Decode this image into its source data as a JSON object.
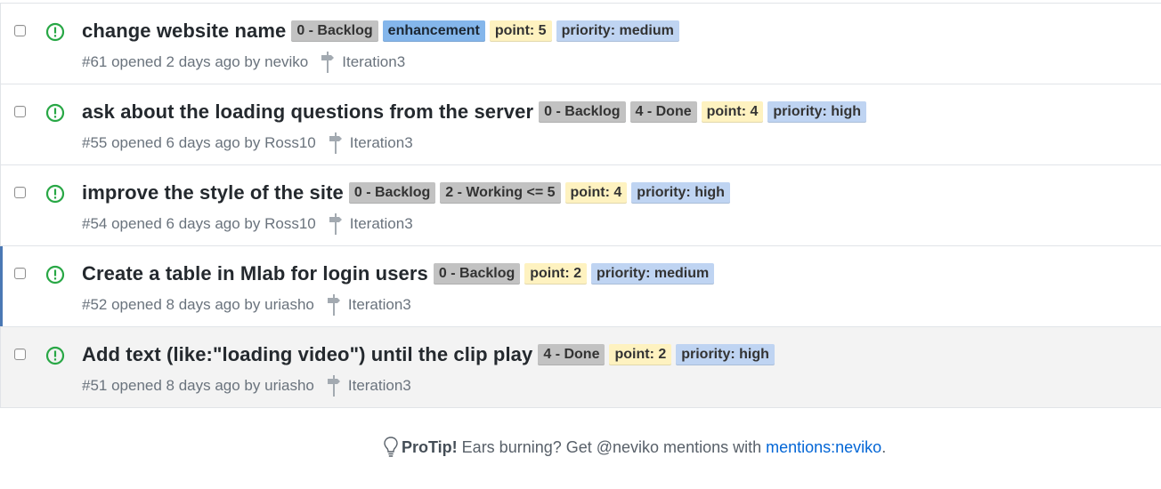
{
  "colors": {
    "open_icon": "#28a745",
    "backlog_bg": "#c2c2c2",
    "done_bg": "#c2c2c2",
    "working_bg": "#c2c2c2",
    "enhancement_bg": "#84b6eb",
    "point_bg": "#fef2c0",
    "priority_bg": "#bfd4f2",
    "active_bar": "#4a78b4",
    "link": "#0366d6"
  },
  "issues": [
    {
      "title": "change website name",
      "labels": [
        "0 - Backlog",
        "enhancement",
        "point: 5",
        "priority: medium"
      ],
      "meta": "#61 opened 2 days ago by neviko",
      "milestone": "Iteration3"
    },
    {
      "title": "ask about the loading questions from the server",
      "labels": [
        "0 - Backlog",
        "4 - Done",
        "point: 4",
        "priority: high"
      ],
      "meta": "#55 opened 6 days ago by Ross10",
      "milestone": "Iteration3"
    },
    {
      "title": "improve the style of the site",
      "labels": [
        "0 - Backlog",
        "2 - Working <= 5",
        "point: 4",
        "priority: high"
      ],
      "meta": "#54 opened 6 days ago by Ross10",
      "milestone": "Iteration3"
    },
    {
      "title": "Create a table in Mlab for login users",
      "labels": [
        "0 - Backlog",
        "point: 2",
        "priority: medium"
      ],
      "meta": "#52 opened 8 days ago by uriasho",
      "milestone": "Iteration3"
    },
    {
      "title": "Add text (like:\"loading video\") until the clip play",
      "labels": [
        "4 - Done",
        "point: 2",
        "priority: high"
      ],
      "meta": "#51 opened 8 days ago by uriasho",
      "milestone": "Iteration3"
    }
  ],
  "protip": {
    "icon": "lightbulb-icon",
    "bold": "ProTip!",
    "text": "Ears burning? Get @neviko mentions with",
    "link": "mentions:neviko",
    "end": "."
  }
}
